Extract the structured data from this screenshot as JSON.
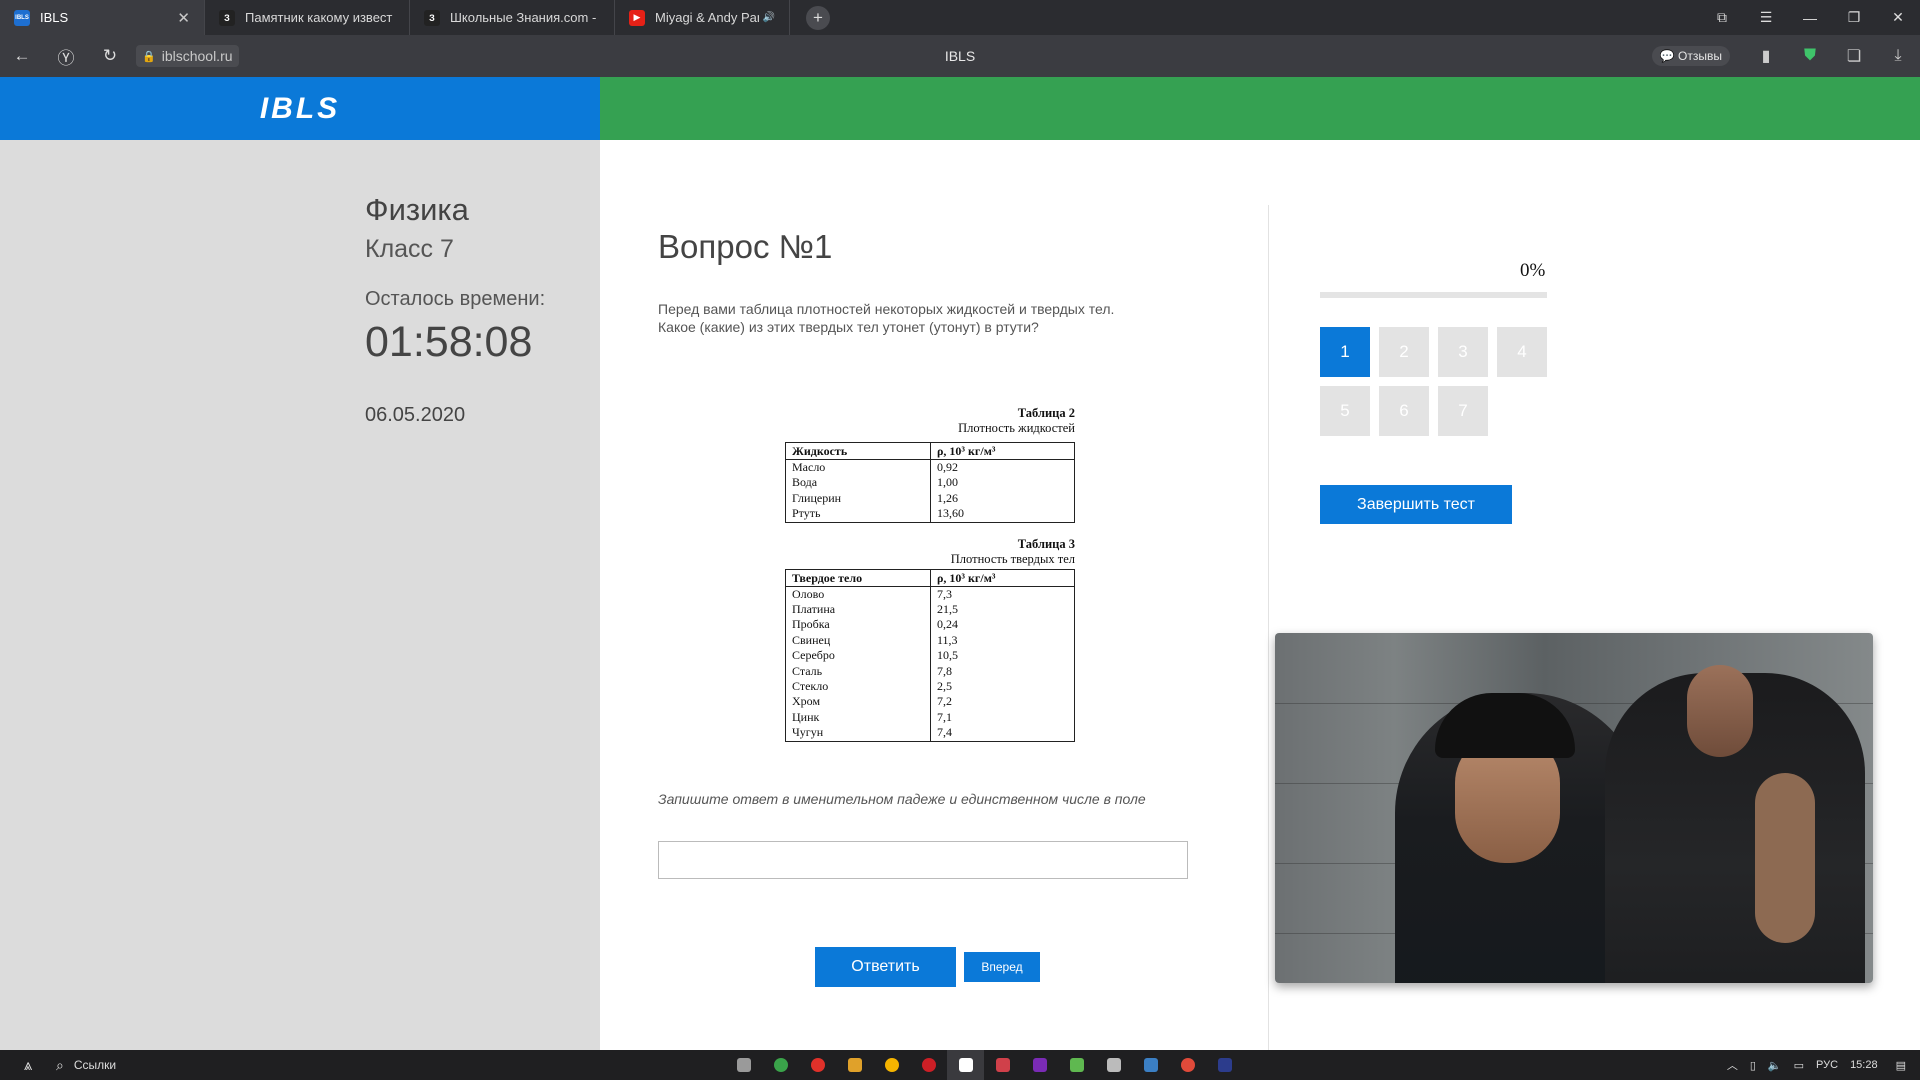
{
  "browser": {
    "tabs": [
      {
        "title": "IBLS",
        "favicon": "IBLS",
        "color": "#1e6fd0",
        "active": true
      },
      {
        "title": "Памятник какому извест",
        "favicon": "З",
        "color": "#222222",
        "active": false
      },
      {
        "title": "Школьные Знания.com -",
        "favicon": "З",
        "color": "#222222",
        "active": false
      },
      {
        "title": "Miyagi & Andy Panc",
        "favicon": "▶",
        "color": "#e62117",
        "active": false
      }
    ],
    "url": "iblschool.ru",
    "page_title": "IBLS",
    "reviews_label": "Отзывы"
  },
  "site": {
    "logo": "IBLS",
    "colors": {
      "blue": "#0b79d8",
      "green": "#35a152",
      "sidebar": "#dcdcdc"
    },
    "sidebar": {
      "subject": "Физика",
      "grade": "Класс 7",
      "time_label": "Осталось времени:",
      "timer": "01:58:08",
      "date": "06.05.2020"
    },
    "question": {
      "title": "Вопрос №1",
      "text_line1": "Перед вами таблица плотностей некоторых жидкостей и твердых тел.",
      "text_line2": "Какое (какие) из этих твердых тел утонет (утонут) в ртути?",
      "instruction": "Запишите ответ в именительном падеже и единственном числе в поле",
      "answer_value": "",
      "answer_button": "Ответить",
      "next_button": "Вперед"
    },
    "table2": {
      "caption": "Таблица 2",
      "subtitle": "Плотность жидкостей",
      "col1": "Жидкость",
      "col2": "ρ, 10³ кг/м³",
      "rows": [
        [
          "Масло",
          "0,92"
        ],
        [
          "Вода",
          "1,00"
        ],
        [
          "Глицерин",
          "1,26"
        ],
        [
          "Ртуть",
          "13,60"
        ]
      ]
    },
    "table3": {
      "caption": "Таблица 3",
      "subtitle": "Плотность твердых тел",
      "col1": "Твердое тело",
      "col2": "ρ, 10³ кг/м³",
      "rows": [
        [
          "Олово",
          "7,3"
        ],
        [
          "Платина",
          "21,5"
        ],
        [
          "Пробка",
          "0,24"
        ],
        [
          "Свинец",
          "11,3"
        ],
        [
          "Серебро",
          "10,5"
        ],
        [
          "Сталь",
          "7,8"
        ],
        [
          "Стекло",
          "2,5"
        ],
        [
          "Хром",
          "7,2"
        ],
        [
          "Цинк",
          "7,1"
        ],
        [
          "Чугун",
          "7,4"
        ]
      ]
    },
    "progress": {
      "label": "0%",
      "fraction": 0
    },
    "questions": [
      "1",
      "2",
      "3",
      "4",
      "5",
      "6",
      "7"
    ],
    "current_question": "1",
    "finish_button": "Завершить тест"
  },
  "taskbar": {
    "search_label": "Ссылки",
    "lang": "РУС",
    "clock": "15:28",
    "apps": [
      "#9a9a9a",
      "#3aa34a",
      "#e0312a",
      "#e0a12a",
      "#f5b400",
      "#cc1f26",
      "#ffffff",
      "#d0404a",
      "#7a2bb5",
      "#5fb850",
      "#bbbbbb",
      "#3b7fc4",
      "#e04a3a",
      "#2c3c8c"
    ]
  }
}
